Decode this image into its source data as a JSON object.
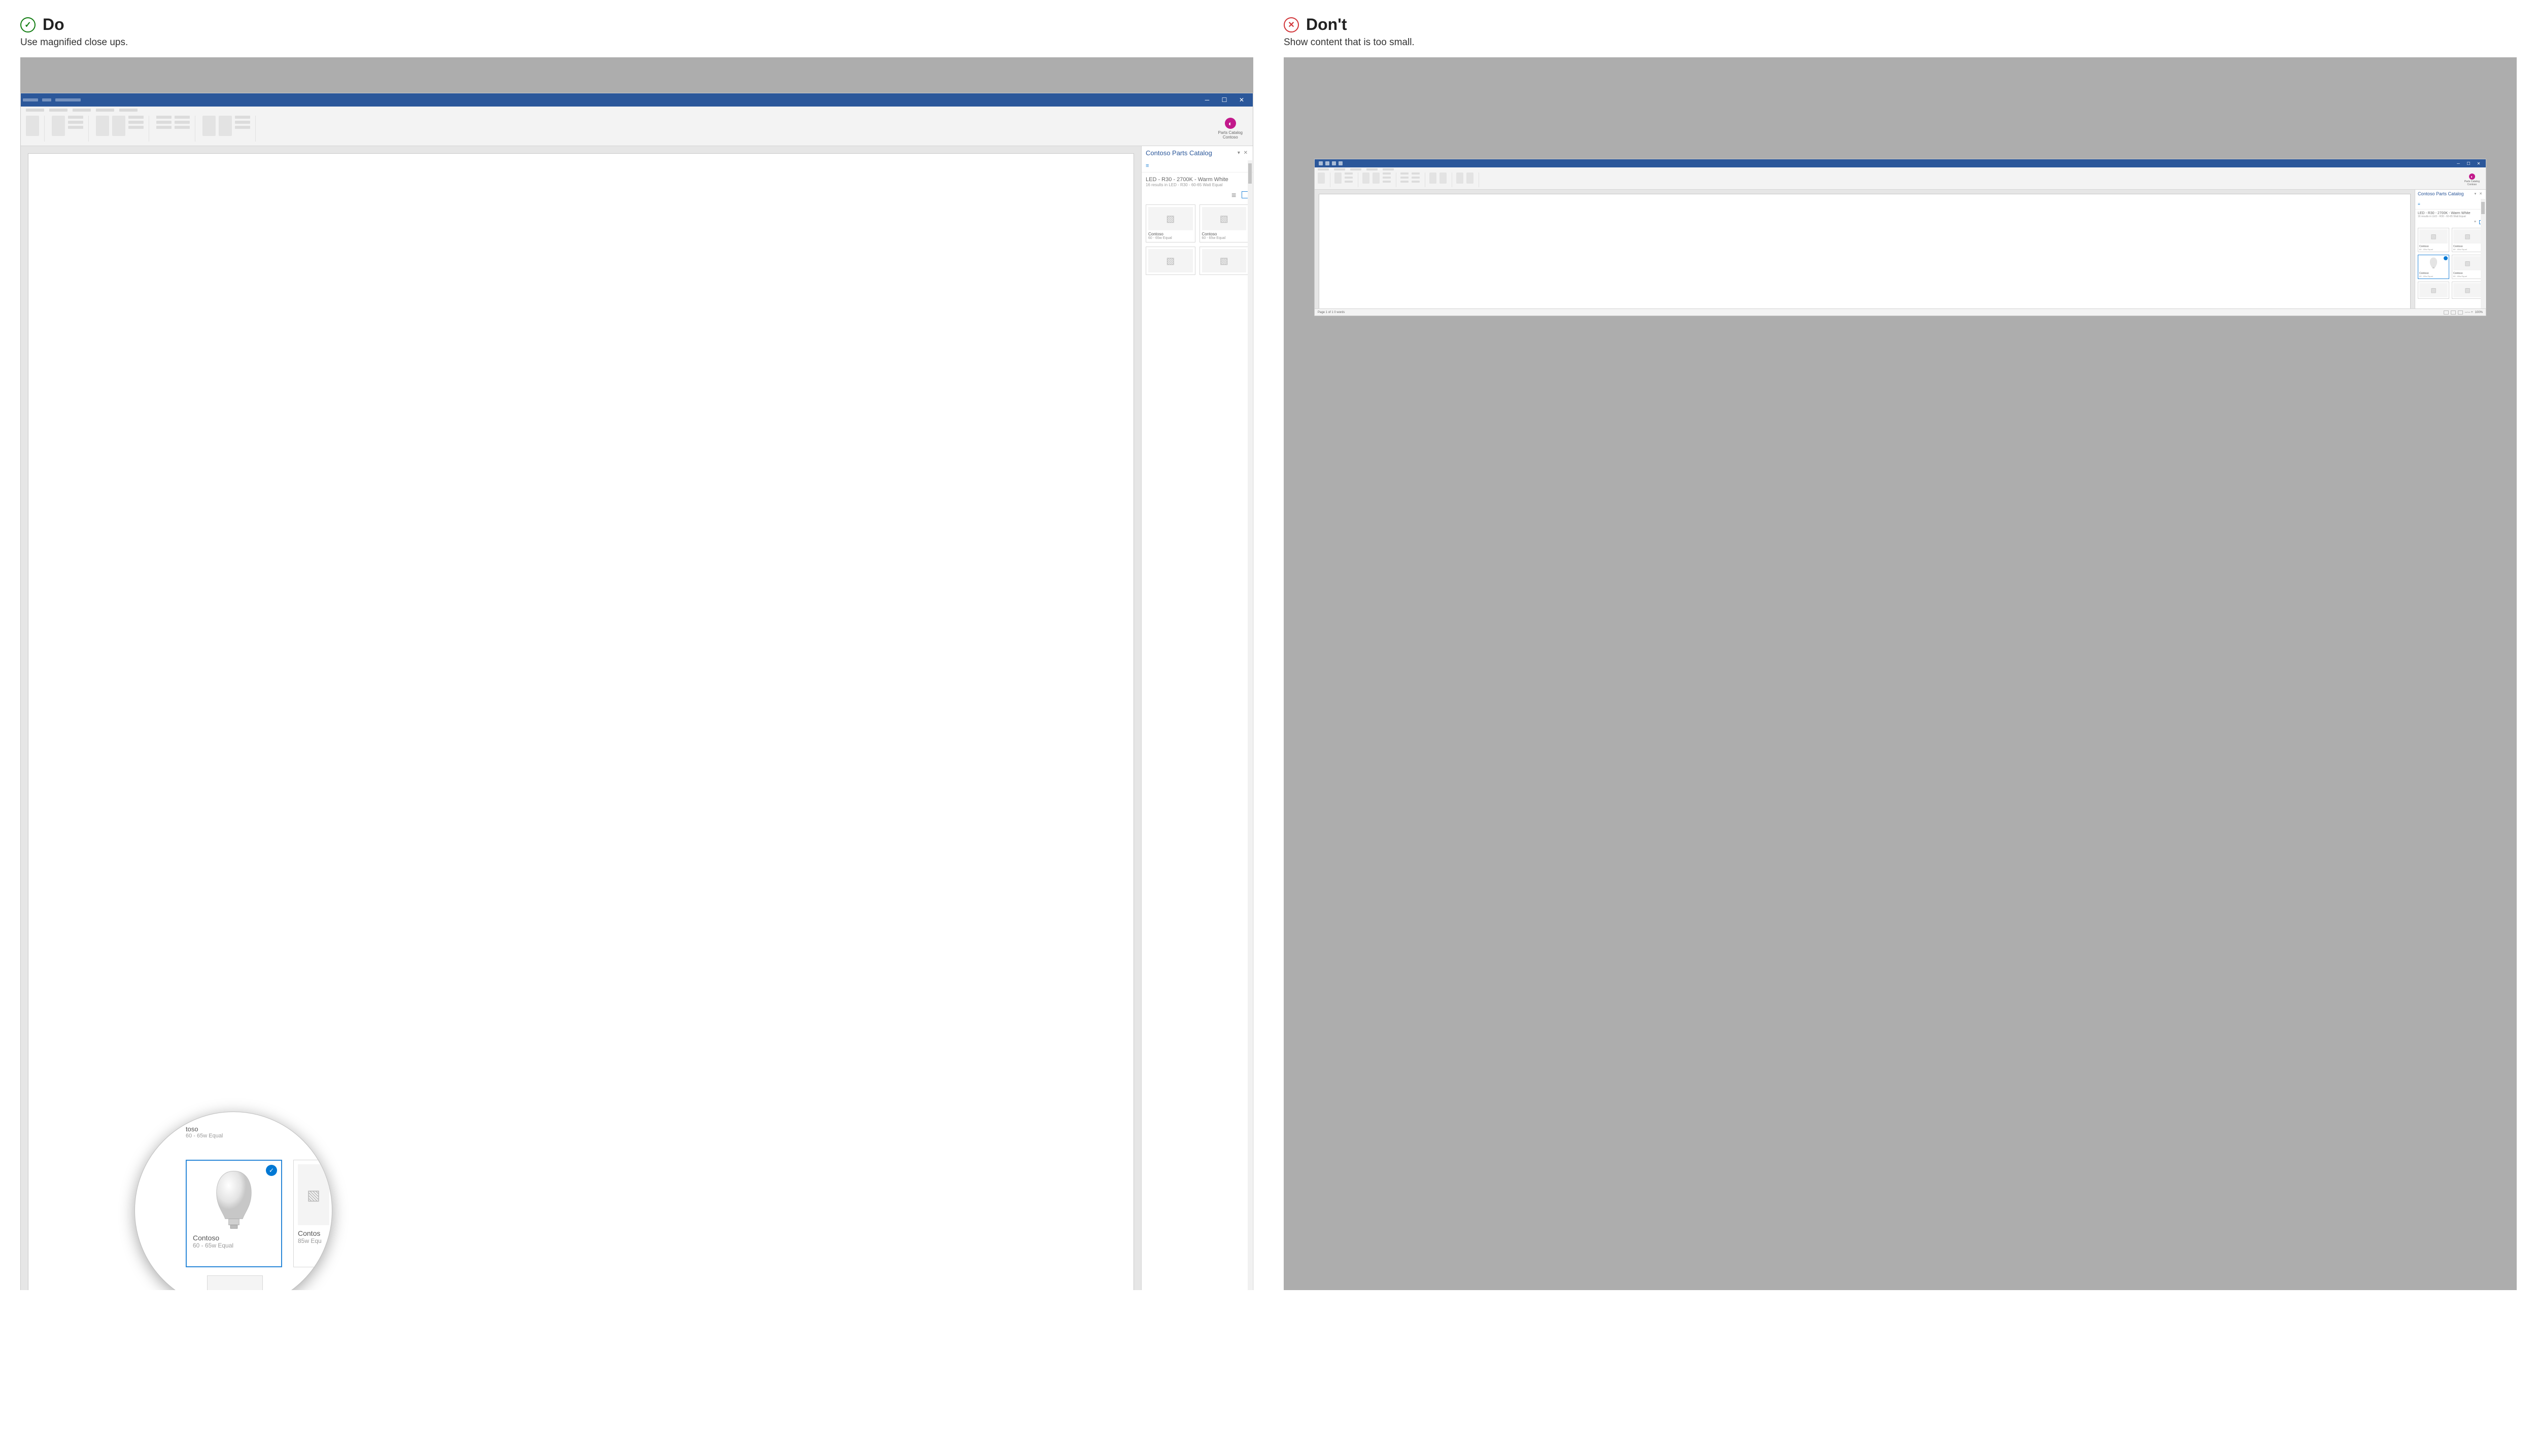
{
  "do": {
    "title": "Do",
    "subtitle": "Use magnified close ups.",
    "badge_glyph": "✓"
  },
  "dont": {
    "title": "Don't",
    "subtitle": "Show content that is too small.",
    "badge_glyph": "✕"
  },
  "app": {
    "addin_name": "Parts Catalog",
    "addin_vendor": "Contoso",
    "pane_title": "Contoso Parts Catalog",
    "pane_controls": "▾ ✕",
    "search_query": "LED - R30 - 2700K - Warm White",
    "search_results": "16 results in LED - R30 - 60-65 Watt Equal",
    "zoom": "100%",
    "footer_brand": "Contoso",
    "status_left": "Page 1 of 1    0 words",
    "status_zoom": "100%"
  },
  "products": {
    "peek": {
      "name": "toso",
      "spec": "60 - 65w Equal"
    },
    "selected": {
      "name": "Contoso",
      "spec": "60 - 65w Equal"
    },
    "side": {
      "name": "Contos",
      "spec": "85w Equ"
    },
    "generic": {
      "name": "Contoso",
      "spec": "60 - 65w Equal"
    }
  }
}
